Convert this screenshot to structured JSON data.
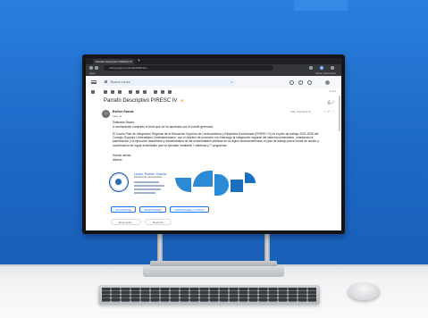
{
  "browser": {
    "tab_title": "Parrafo Descriptivo PIRESC IV",
    "new_tab": "+",
    "address": "mail.google.com/mail/u/0/#inbox",
    "bookmarks_label": "Apps",
    "bookmarks_right": "Other bookmarks"
  },
  "gmail": {
    "search_placeholder": "Buscar correo",
    "pager": "1 of 1"
  },
  "email": {
    "subject": "Parrafo Descriptivo PIRESC IV",
    "sender_name": "Esther Garcia",
    "to_line": "para mí",
    "date": "Feb. 2 (hace 1 h)",
    "greeting": "Estimado Álvaro,",
    "intro": "a continuación comparto el texto que se ha aprobado por el comité gerencial:",
    "paragraph": "El Cuarto Plan de Integración Regional de la Educación Superior de Centroamérica y República Dominicana (PIRESC IV) es el plan de trabajo 2021-2026 del Consejo Superior Universitario Centroamericano, con el objetivo de promover con liderazgo la integración regional del sistema universitario, orientando la planificación y la ejecución académica y administrativa de las universidades públicas en la región centroamericana; el plan de trabajo prevé líneas de acción y coordinación de lograr actividades que se ejecutan mediante 7 sistemas y 7 programas.",
    "closing": "Saludo atento,",
    "closing_name": "Alberto"
  },
  "signature": {
    "name": "Licda. Esther Garcia",
    "role": "Directora de Comunicación"
  },
  "actions": {
    "btn1": "SIGNATURE",
    "btn2": "RESPONDER",
    "btn3": "RESPONDER A TODOS",
    "reply": "Responder",
    "forward": "Reenviar"
  },
  "colors": {
    "wall": "#1f6fd0",
    "accent": "#2a8ad6",
    "link": "#1a73e8"
  }
}
